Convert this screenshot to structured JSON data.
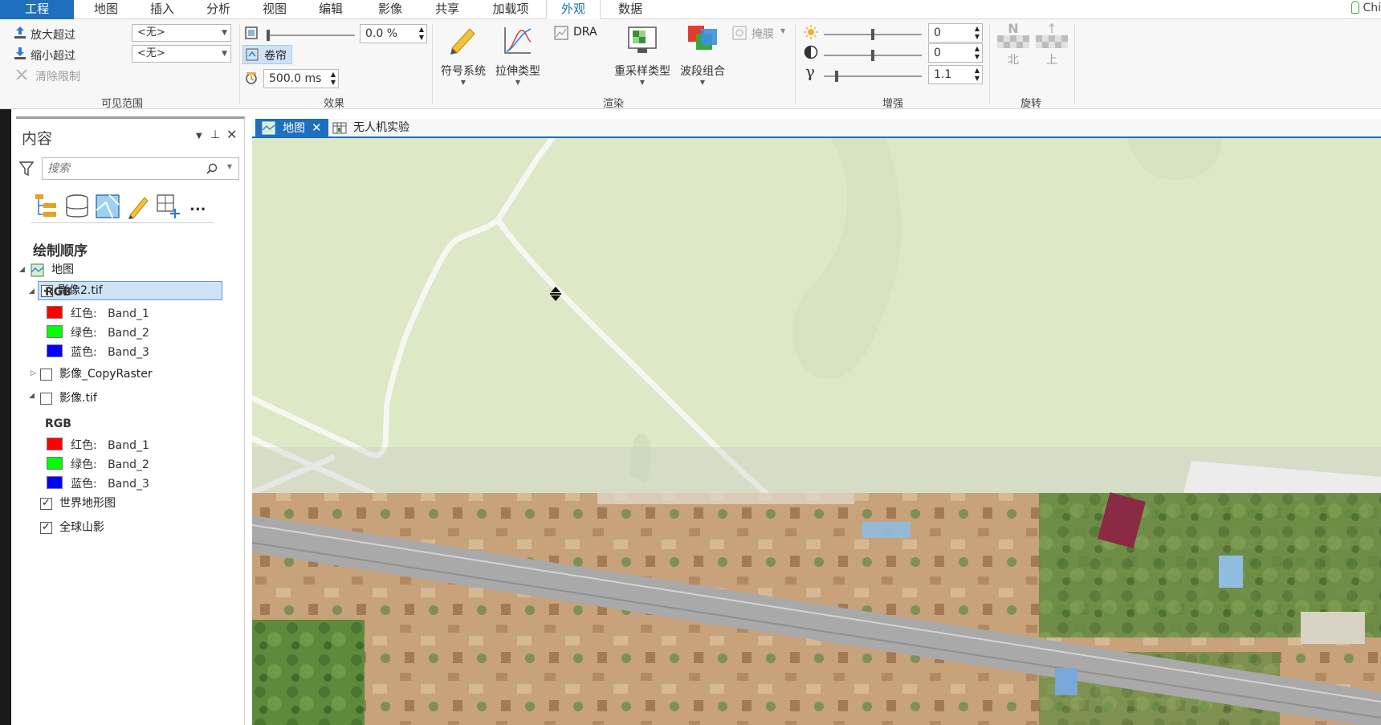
{
  "menu": {
    "tabs": [
      {
        "label": "工程"
      },
      {
        "label": "地图"
      },
      {
        "label": "插入"
      },
      {
        "label": "分析"
      },
      {
        "label": "视图"
      },
      {
        "label": "编辑"
      },
      {
        "label": "影像"
      },
      {
        "label": "共享"
      },
      {
        "label": "加载项"
      },
      {
        "label": "外观"
      },
      {
        "label": "数据"
      }
    ],
    "active_tab": "外观",
    "user_label": "Chi"
  },
  "ribbon": {
    "visible_range": {
      "group_label": "可见范围",
      "zoom_in_beyond": "放大超过",
      "zoom_out_beyond": "缩小超过",
      "clear_limits": "清除限制",
      "zoom_in_value": "<无>",
      "zoom_out_value": "<无>"
    },
    "effects": {
      "group_label": "效果",
      "transparency_value": "0.0 %",
      "transparency_level": 0,
      "swipe_label": "卷帘",
      "flicker_value": "500.0  ms"
    },
    "rendering": {
      "group_label": "渲染",
      "symbology": "符号系统",
      "stretch_type": "拉伸类型",
      "dra": "DRA",
      "resampling_type": "重采样类型",
      "band_combination": "波段组合",
      "mask": "掩膜"
    },
    "enhance": {
      "group_label": "增强",
      "brightness_value": "0",
      "contrast_value": "0",
      "gamma_value": "1.1"
    },
    "rotation": {
      "group_label": "旋转",
      "north": "北",
      "up": "上",
      "north_glyph": "N"
    }
  },
  "contents": {
    "title": "内容",
    "search_placeholder": "搜索",
    "section_title": "绘制顺序",
    "more_label": "...",
    "map_node": "地图",
    "layers": [
      {
        "name": "影像2.tif",
        "checked": true,
        "selected": true,
        "renderer": "RGB",
        "bands": [
          {
            "label": "红色:",
            "band": "Band_1",
            "color": "#ff0000"
          },
          {
            "label": "绿色:",
            "band": "Band_2",
            "color": "#00ff00"
          },
          {
            "label": "蓝色:",
            "band": "Band_3",
            "color": "#0000ff"
          }
        ]
      },
      {
        "name": "影像_CopyRaster",
        "checked": false,
        "selected": false
      },
      {
        "name": "影像.tif",
        "checked": false,
        "selected": false,
        "renderer": "RGB",
        "bands": [
          {
            "label": "红色:",
            "band": "Band_1",
            "color": "#ff0000"
          },
          {
            "label": "绿色:",
            "band": "Band_2",
            "color": "#00ff00"
          },
          {
            "label": "蓝色:",
            "band": "Band_3",
            "color": "#0000ff"
          }
        ]
      },
      {
        "name": "世界地形图",
        "checked": true,
        "selected": false
      },
      {
        "name": "全球山影",
        "checked": true,
        "selected": false
      }
    ]
  },
  "map_view": {
    "tabs": [
      {
        "label": "地图",
        "active": true
      },
      {
        "label": "无人机实验",
        "active": false
      }
    ]
  },
  "colors": {
    "accent": "#1f6fbf",
    "basemap_land": "#dde8c6",
    "selection": "#cfe3f7"
  }
}
